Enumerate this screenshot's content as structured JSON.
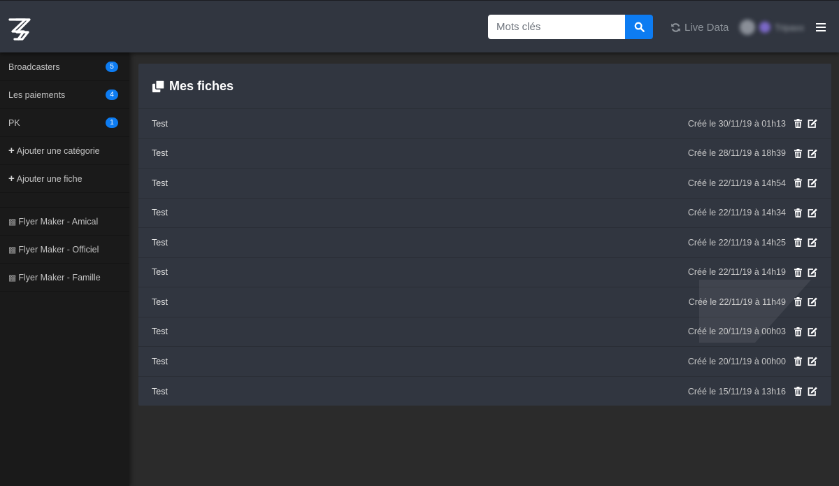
{
  "header": {
    "search_placeholder": "Mots clés",
    "live_data_label": "Live Data",
    "user_name": "Tripaxx"
  },
  "sidebar": {
    "items": [
      {
        "label": "Broadcasters",
        "badge": "5"
      },
      {
        "label": "Les paiements",
        "badge": "4"
      },
      {
        "label": "PK",
        "badge": "1"
      },
      {
        "label": "Ajouter une catégorie"
      },
      {
        "label": "Ajouter une fiche"
      }
    ],
    "flyers": [
      {
        "label": "Flyer Maker - Amical"
      },
      {
        "label": "Flyer Maker - Officiel"
      },
      {
        "label": "Flyer Maker - Famille"
      }
    ]
  },
  "panel": {
    "title": "Mes fiches",
    "rows": [
      {
        "name": "Test",
        "date": "Créé le 30/11/19 à 01h13"
      },
      {
        "name": "Test",
        "date": "Créé le 28/11/19 à 18h39"
      },
      {
        "name": "Test",
        "date": "Créé le 22/11/19 à 14h54"
      },
      {
        "name": "Test",
        "date": "Créé le 22/11/19 à 14h34"
      },
      {
        "name": "Test",
        "date": "Créé le 22/11/19 à 14h25"
      },
      {
        "name": "Test",
        "date": "Créé le 22/11/19 à 14h19"
      },
      {
        "name": "Test",
        "date": "Créé le 22/11/19 à 11h49"
      },
      {
        "name": "Test",
        "date": "Créé le 20/11/19 à 00h03"
      },
      {
        "name": "Test",
        "date": "Créé le 20/11/19 à 00h00"
      },
      {
        "name": "Test",
        "date": "Créé le 15/11/19 à 13h16"
      }
    ]
  },
  "colors": {
    "accent": "#0d7cf2",
    "header_bg": "#313640",
    "sidebar_bg": "#1a1a1a",
    "page_bg": "#2b2b2b"
  },
  "icons": {
    "logo": "zz-logo",
    "search": "search-icon",
    "live_data": "refresh-icon",
    "menu": "hamburger-icon",
    "panel_title": "copy-icon",
    "delete": "trash-icon",
    "edit": "edit-icon",
    "add": "plus-icon",
    "flyer": "checker-icon"
  }
}
